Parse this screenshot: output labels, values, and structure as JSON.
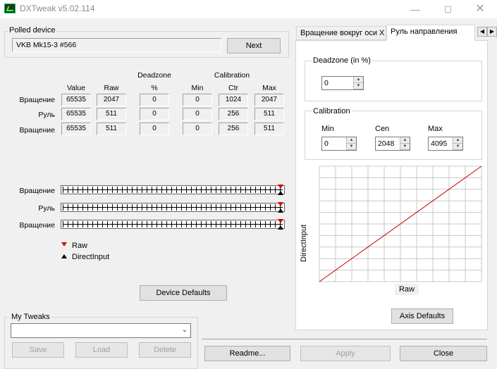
{
  "window": {
    "title": "DXTweak v5.02.114",
    "minimize": "—",
    "close": "✕"
  },
  "polled": {
    "legend": "Polled device",
    "device": "VKB Mk15-3 #566",
    "next_label": "Next"
  },
  "table": {
    "headers": {
      "value": "Value",
      "raw": "Raw",
      "deadzone": "Deadzone",
      "deadzone_unit": "%",
      "calibration": "Calibration",
      "min": "Min",
      "ctr": "Ctr",
      "max": "Max"
    },
    "rows": [
      {
        "label": "Вращение",
        "value": "65535",
        "raw": "2047",
        "dz": "0",
        "min": "0",
        "ctr": "1024",
        "max": "2047"
      },
      {
        "label": "Руль",
        "value": "65535",
        "raw": "511",
        "dz": "0",
        "min": "0",
        "ctr": "256",
        "max": "511"
      },
      {
        "label": "Вращение",
        "value": "65535",
        "raw": "511",
        "dz": "0",
        "min": "0",
        "ctr": "256",
        "max": "511"
      }
    ]
  },
  "sliders": [
    {
      "label": "Вращение",
      "raw_position": 1.0,
      "di_position": 1.0
    },
    {
      "label": "Руль",
      "raw_position": 1.0,
      "di_position": 1.0
    },
    {
      "label": "Вращение",
      "raw_position": 1.0,
      "di_position": 1.0
    }
  ],
  "legend_markers": {
    "raw": "Raw",
    "directinput": "DirectInput"
  },
  "buttons": {
    "device_defaults": "Device Defaults",
    "readme": "Readme...",
    "apply": "Apply",
    "close": "Close",
    "save": "Save",
    "load": "Load",
    "delete": "Delete",
    "axis_defaults": "Axis Defaults"
  },
  "tweaks": {
    "legend": "My Tweaks",
    "selected": ""
  },
  "tabs": [
    {
      "label": "Вращение вокруг оси X",
      "active": false
    },
    {
      "label": "Руль направления",
      "active": true
    }
  ],
  "axis_panel": {
    "deadzone_legend": "Deadzone (in %)",
    "deadzone_value": "0",
    "calibration_legend": "Calibration",
    "min_label": "Min",
    "min_value": "0",
    "cen_label": "Cen",
    "cen_value": "2048",
    "max_label": "Max",
    "max_value": "4095",
    "graph_xlabel": "Raw",
    "graph_ylabel": "DirectInput"
  },
  "colors": {
    "raw_marker": "#e00000",
    "di_marker": "#000000",
    "curve": "#c00000"
  },
  "chart_data": {
    "type": "line",
    "x": [
      0,
      1
    ],
    "series": [
      {
        "values": [
          0,
          1
        ]
      }
    ],
    "xlabel": "Raw",
    "ylabel": "DirectInput",
    "grid": true
  }
}
